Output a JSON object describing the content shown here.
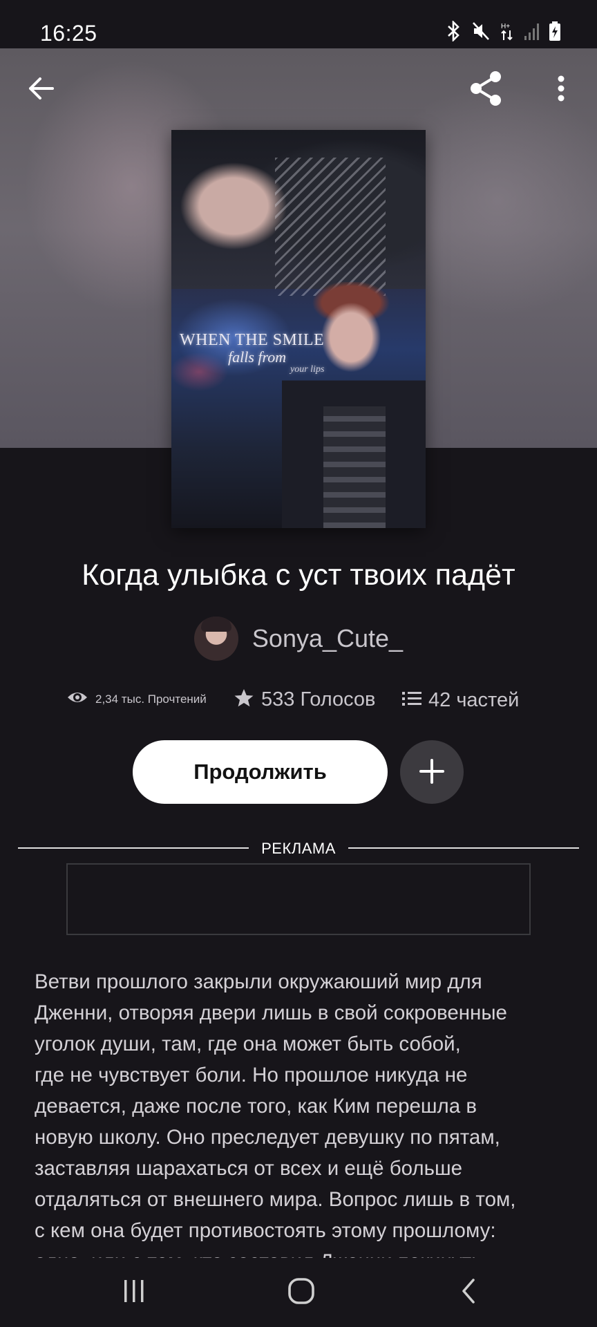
{
  "status_bar": {
    "time": "16:25",
    "icons": [
      "bluetooth-icon",
      "mute-icon",
      "data-arrows-icon",
      "signal-icon",
      "battery-charging-icon"
    ]
  },
  "toolbar": {
    "back_icon": "arrow-left-icon",
    "share_icon": "share-icon",
    "more_icon": "more-vertical-icon"
  },
  "cover": {
    "line1": "WHEN THE SMILE",
    "line2": "falls from",
    "line3": "your lips"
  },
  "story": {
    "title": "Когда улыбка с уст твоих падёт",
    "author": "Sonya_Cute_"
  },
  "stats": {
    "reads": "2,34 тыс. Прочтений",
    "votes": "533 Голосов",
    "parts": "42 частей"
  },
  "actions": {
    "continue_label": "Продолжить",
    "add_icon": "plus-icon"
  },
  "ad": {
    "label": "РЕКЛАМА"
  },
  "description": {
    "lines": [
      "Ветви прошлого закрыли окружаюший мир для",
      "Дженни, отворяя двери лишь в свой сокровенные",
      "уголок души, там, где она может быть собой,",
      "где не чувствует боли. Но прошлое никуда не",
      "девается, даже после того, как Ким перешла в",
      "новую школу. Оно преследует девушку по пятам,",
      "заставляя шарахаться от всех и ещё больше",
      "отдаляться от внешнего мира. Вопрос лишь в том,",
      "с кем она будет противостоять этому прошлому:",
      "одна, или с тем, кто заставил Дженни покинуть"
    ]
  },
  "nav_bar": {
    "items": [
      "recents-icon",
      "home-icon",
      "back-icon"
    ]
  }
}
